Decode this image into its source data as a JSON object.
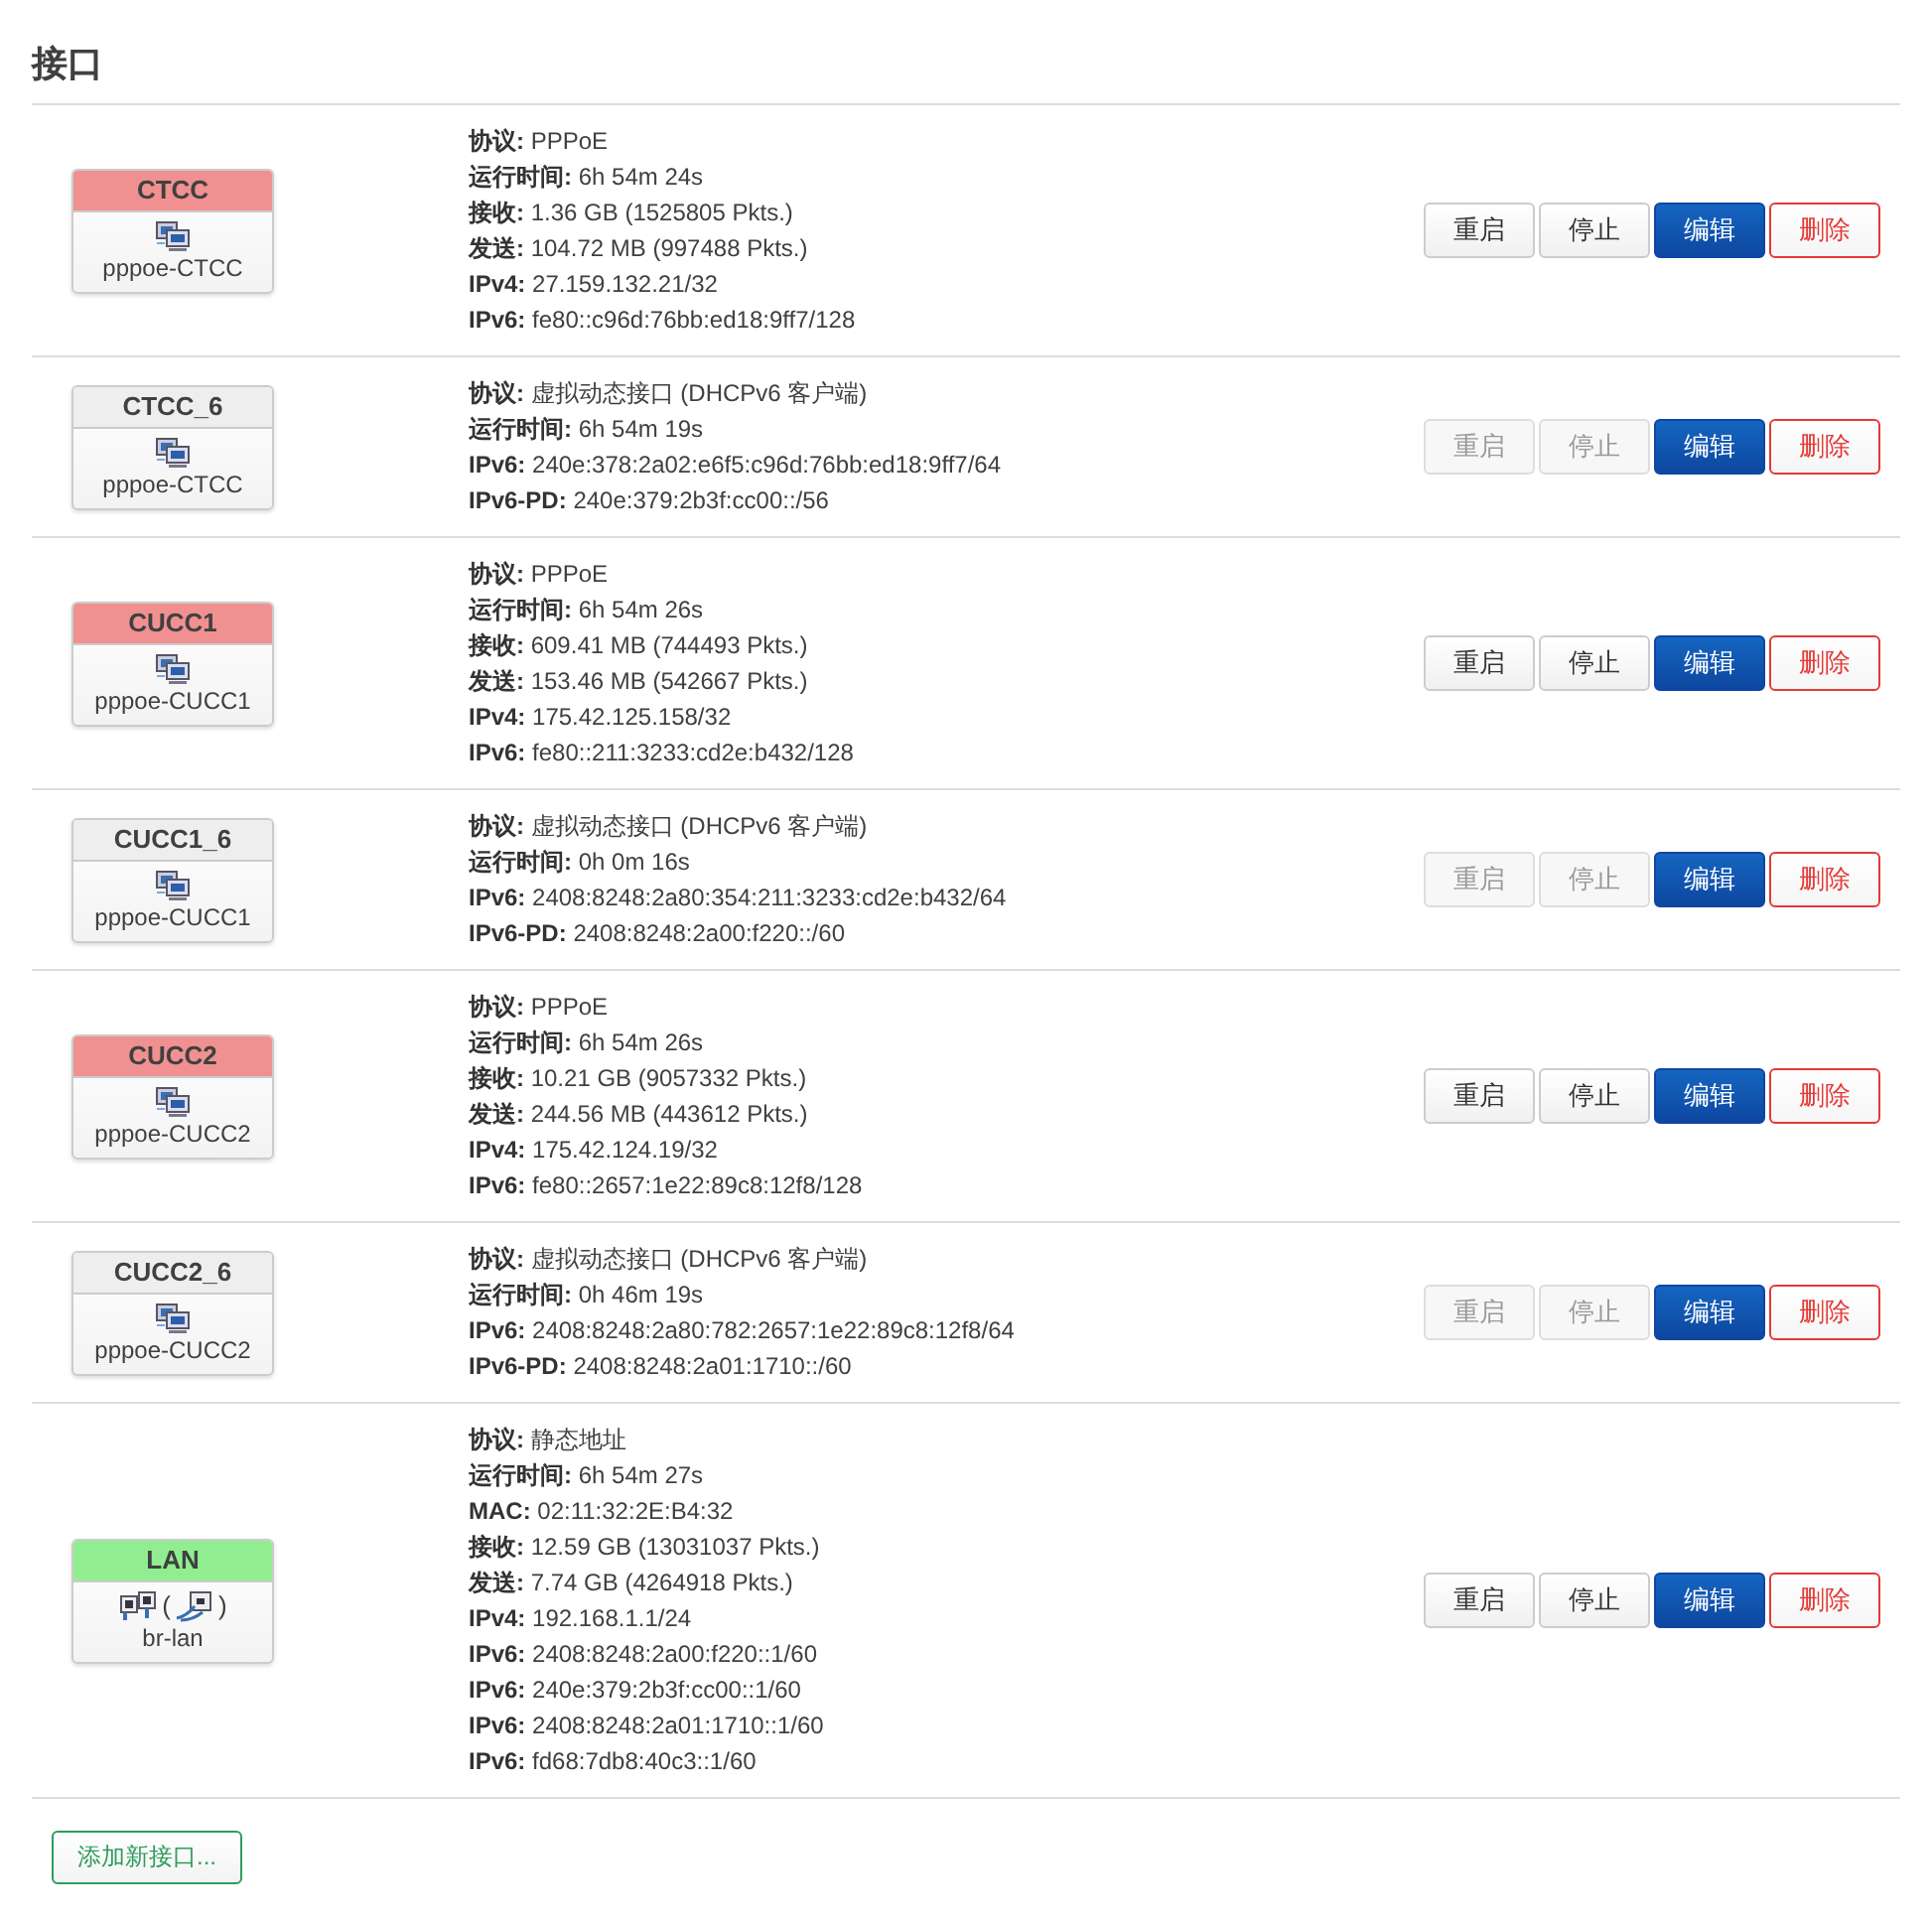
{
  "title": "接口",
  "interfaces": [
    {
      "name": "CTCC",
      "color": "#f09090",
      "device": "pppoe-CTCC",
      "icons": [
        {
          "kind": "network"
        }
      ],
      "details": [
        {
          "label": "协议:",
          "value": "PPPoE"
        },
        {
          "label": "运行时间:",
          "value": "6h 54m 24s"
        },
        {
          "label": "接收:",
          "value": "1.36 GB (1525805 Pkts.)"
        },
        {
          "label": "发送:",
          "value": "104.72 MB (997488 Pkts.)"
        },
        {
          "label": "IPv4:",
          "value": "27.159.132.21/32"
        },
        {
          "label": "IPv6:",
          "value": "fe80::c96d:76bb:ed18:9ff7/128"
        }
      ],
      "buttons": [
        {
          "kind": "plain",
          "label": "重启",
          "disabled": false
        },
        {
          "kind": "plain",
          "label": "停止",
          "disabled": false
        },
        {
          "kind": "primary",
          "label": "编辑",
          "disabled": false
        },
        {
          "kind": "danger",
          "label": "删除",
          "disabled": false
        }
      ]
    },
    {
      "name": "CTCC_6",
      "color": "#eeeeee",
      "device": "pppoe-CTCC",
      "icons": [
        {
          "kind": "network"
        }
      ],
      "details": [
        {
          "label": "协议:",
          "value": "虚拟动态接口 (DHCPv6 客户端)"
        },
        {
          "label": "运行时间:",
          "value": "6h 54m 19s"
        },
        {
          "label": "IPv6:",
          "value": "240e:378:2a02:e6f5:c96d:76bb:ed18:9ff7/64"
        },
        {
          "label": "IPv6-PD:",
          "value": "240e:379:2b3f:cc00::/56"
        }
      ],
      "buttons": [
        {
          "kind": "plain",
          "label": "重启",
          "disabled": true
        },
        {
          "kind": "plain",
          "label": "停止",
          "disabled": true
        },
        {
          "kind": "primary",
          "label": "编辑",
          "disabled": false
        },
        {
          "kind": "danger",
          "label": "删除",
          "disabled": false
        }
      ]
    },
    {
      "name": "CUCC1",
      "color": "#f09090",
      "device": "pppoe-CUCC1",
      "icons": [
        {
          "kind": "network"
        }
      ],
      "details": [
        {
          "label": "协议:",
          "value": "PPPoE"
        },
        {
          "label": "运行时间:",
          "value": "6h 54m 26s"
        },
        {
          "label": "接收:",
          "value": "609.41 MB (744493 Pkts.)"
        },
        {
          "label": "发送:",
          "value": "153.46 MB (542667 Pkts.)"
        },
        {
          "label": "IPv4:",
          "value": "175.42.125.158/32"
        },
        {
          "label": "IPv6:",
          "value": "fe80::211:3233:cd2e:b432/128"
        }
      ],
      "buttons": [
        {
          "kind": "plain",
          "label": "重启",
          "disabled": false
        },
        {
          "kind": "plain",
          "label": "停止",
          "disabled": false
        },
        {
          "kind": "primary",
          "label": "编辑",
          "disabled": false
        },
        {
          "kind": "danger",
          "label": "删除",
          "disabled": false
        }
      ]
    },
    {
      "name": "CUCC1_6",
      "color": "#eeeeee",
      "device": "pppoe-CUCC1",
      "icons": [
        {
          "kind": "network"
        }
      ],
      "details": [
        {
          "label": "协议:",
          "value": "虚拟动态接口 (DHCPv6 客户端)"
        },
        {
          "label": "运行时间:",
          "value": "0h 0m 16s"
        },
        {
          "label": "IPv6:",
          "value": "2408:8248:2a80:354:211:3233:cd2e:b432/64"
        },
        {
          "label": "IPv6-PD:",
          "value": "2408:8248:2a00:f220::/60"
        }
      ],
      "buttons": [
        {
          "kind": "plain",
          "label": "重启",
          "disabled": true
        },
        {
          "kind": "plain",
          "label": "停止",
          "disabled": true
        },
        {
          "kind": "primary",
          "label": "编辑",
          "disabled": false
        },
        {
          "kind": "danger",
          "label": "删除",
          "disabled": false
        }
      ]
    },
    {
      "name": "CUCC2",
      "color": "#f09090",
      "device": "pppoe-CUCC2",
      "icons": [
        {
          "kind": "network"
        }
      ],
      "details": [
        {
          "label": "协议:",
          "value": "PPPoE"
        },
        {
          "label": "运行时间:",
          "value": "6h 54m 26s"
        },
        {
          "label": "接收:",
          "value": "10.21 GB (9057332 Pkts.)"
        },
        {
          "label": "发送:",
          "value": "244.56 MB (443612 Pkts.)"
        },
        {
          "label": "IPv4:",
          "value": "175.42.124.19/32"
        },
        {
          "label": "IPv6:",
          "value": "fe80::2657:1e22:89c8:12f8/128"
        }
      ],
      "buttons": [
        {
          "kind": "plain",
          "label": "重启",
          "disabled": false
        },
        {
          "kind": "plain",
          "label": "停止",
          "disabled": false
        },
        {
          "kind": "primary",
          "label": "编辑",
          "disabled": false
        },
        {
          "kind": "danger",
          "label": "删除",
          "disabled": false
        }
      ]
    },
    {
      "name": "CUCC2_6",
      "color": "#eeeeee",
      "device": "pppoe-CUCC2",
      "icons": [
        {
          "kind": "network"
        }
      ],
      "details": [
        {
          "label": "协议:",
          "value": "虚拟动态接口 (DHCPv6 客户端)"
        },
        {
          "label": "运行时间:",
          "value": "0h 46m 19s"
        },
        {
          "label": "IPv6:",
          "value": "2408:8248:2a80:782:2657:1e22:89c8:12f8/64"
        },
        {
          "label": "IPv6-PD:",
          "value": "2408:8248:2a01:1710::/60"
        }
      ],
      "buttons": [
        {
          "kind": "plain",
          "label": "重启",
          "disabled": true
        },
        {
          "kind": "plain",
          "label": "停止",
          "disabled": true
        },
        {
          "kind": "primary",
          "label": "编辑",
          "disabled": false
        },
        {
          "kind": "danger",
          "label": "删除",
          "disabled": false
        }
      ]
    },
    {
      "name": "LAN",
      "color": "#90ee90",
      "device": "br-lan",
      "icons": [
        {
          "kind": "ports"
        },
        {
          "kind": "text",
          "text": "("
        },
        {
          "kind": "wireless"
        },
        {
          "kind": "text",
          "text": ")"
        }
      ],
      "details": [
        {
          "label": "协议:",
          "value": "静态地址"
        },
        {
          "label": "运行时间:",
          "value": "6h 54m 27s"
        },
        {
          "label": "MAC:",
          "value": "02:11:32:2E:B4:32"
        },
        {
          "label": "接收:",
          "value": "12.59 GB (13031037 Pkts.)"
        },
        {
          "label": "发送:",
          "value": "7.74 GB (4264918 Pkts.)"
        },
        {
          "label": "IPv4:",
          "value": "192.168.1.1/24"
        },
        {
          "label": "IPv6:",
          "value": "2408:8248:2a00:f220::1/60"
        },
        {
          "label": "IPv6:",
          "value": "240e:379:2b3f:cc00::1/60"
        },
        {
          "label": "IPv6:",
          "value": "2408:8248:2a01:1710::1/60"
        },
        {
          "label": "IPv6:",
          "value": "fd68:7db8:40c3::1/60"
        }
      ],
      "buttons": [
        {
          "kind": "plain",
          "label": "重启",
          "disabled": false
        },
        {
          "kind": "plain",
          "label": "停止",
          "disabled": false
        },
        {
          "kind": "primary",
          "label": "编辑",
          "disabled": false
        },
        {
          "kind": "danger",
          "label": "删除",
          "disabled": false
        }
      ]
    }
  ],
  "add_button": {
    "label": "添加新接口..."
  }
}
